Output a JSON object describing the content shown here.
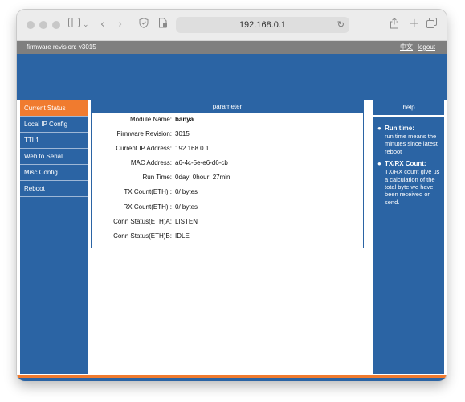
{
  "browser": {
    "address": "192.168.0.1"
  },
  "topbar": {
    "firmware_label": "firmware revision:  v3015",
    "language_link": "中文",
    "logout_link": "logout"
  },
  "sidebar": {
    "items": [
      {
        "label": "Current Status",
        "active": true
      },
      {
        "label": "Local IP Config"
      },
      {
        "label": "TTL1"
      },
      {
        "label": "Web to Serial"
      },
      {
        "label": "Misc Config"
      },
      {
        "label": "Reboot"
      }
    ]
  },
  "main": {
    "header": "parameter",
    "rows": [
      {
        "label": "Module Name:",
        "value": "banya"
      },
      {
        "label": "Firmware Revision:",
        "value": "3015"
      },
      {
        "label": "Current IP Address:",
        "value": "192.168.0.1"
      },
      {
        "label": "MAC Address:",
        "value": "a6-4c-5e-e6-d6-cb"
      },
      {
        "label": "Run Time:",
        "value": "0day: 0hour: 27min"
      },
      {
        "label": "TX Count(ETH) :",
        "value": "0/ bytes"
      },
      {
        "label": "RX Count(ETH) :",
        "value": "0/ bytes"
      },
      {
        "label": "Conn Status(ETH)A:",
        "value": "LISTEN"
      },
      {
        "label": "Conn Status(ETH)B:",
        "value": "IDLE"
      }
    ]
  },
  "help": {
    "header": "help",
    "items": [
      {
        "title": "Run time:",
        "text": "run time means the minutes since latest reboot"
      },
      {
        "title": "TX/RX Count:",
        "text": "TX/RX count give us a calculation of the total byte we have been received or send."
      }
    ]
  },
  "colors": {
    "brand_blue": "#2b64a4",
    "accent_orange": "#f07b2f",
    "topbar_gray": "#7f7f7f"
  }
}
